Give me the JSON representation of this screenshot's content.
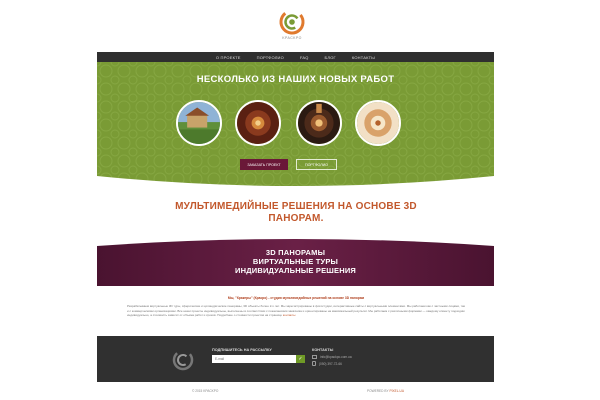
{
  "logo": {
    "text": "KPACKPO"
  },
  "nav": {
    "items": [
      {
        "label": "О ПРОЕКТЕ"
      },
      {
        "label": "ПОРТФОЛИО"
      },
      {
        "label": "FAQ"
      },
      {
        "label": "БЛОГ"
      },
      {
        "label": "КОНТАКТЫ"
      }
    ]
  },
  "hero": {
    "title": "НЕСКОЛЬКО ИЗ НАШИХ НОВЫХ РАБОТ",
    "primary_button": "ЗАКАЗАТЬ ПРОЕКТ",
    "secondary_button": "ПОРТФОЛИО",
    "bg_color": "#7a9b35"
  },
  "headline": {
    "line1": "МУЛЬТИМЕДИЙНЫЕ РЕШЕНИЯ НА ОСНОВЕ 3D",
    "line2": "ПАНОРАМ."
  },
  "banner": {
    "lines": [
      "3D ПАНОРАМЫ",
      "ВИРТУАЛЬНЫЕ ТУРЫ",
      "ИНДИВИДУАЛЬНЫЕ РЕШЕНИЯ"
    ],
    "bg_color": "#5a1a3a"
  },
  "about": {
    "intro": "Мы, \"Кракеры\" (Красро) - студия мультимедийных решений на основе 3D панорам",
    "body": "Разрабатываем виртуальные 3D туры, сферические и цилиндрические панорамы, 3D объекты более 2-х лет. Мы зарегистрированы в фотостудии, интерактивные сайты с виртуальными элементами. Мы работаем как с частными лицами, так и с коммерческими организациями. Все наши проекты индивидуальны, выполнены в соответствии с пожеланиями заказчика и ориентированы на максимальный результат. Мы работаем с различными формами — каждому клиенту подходим индивидуально, а стоимость зависит от объема работ и сроков. Подробнее о стоимости проектов на странице",
    "link": "контакты"
  },
  "footer": {
    "subscribe_label": "ПОДПИШИТЕСЬ НА РАССЫЛКУ",
    "subscribe_placeholder": "E-mail",
    "subscribe_button_icon": "check-icon",
    "contacts_label": "КОНТАКТЫ",
    "email": "info@kpackpo.com.ua",
    "phone": "(050) 397-72-66"
  },
  "bottom": {
    "copyright": "© 2015 KPACKPO",
    "powered_prefix": "POWERED BY",
    "powered_brand": "PIXEL-UA"
  },
  "colors": {
    "accent": "#c2582c",
    "green": "#7a9b35",
    "maroon": "#6a1838",
    "dark": "#303030"
  }
}
